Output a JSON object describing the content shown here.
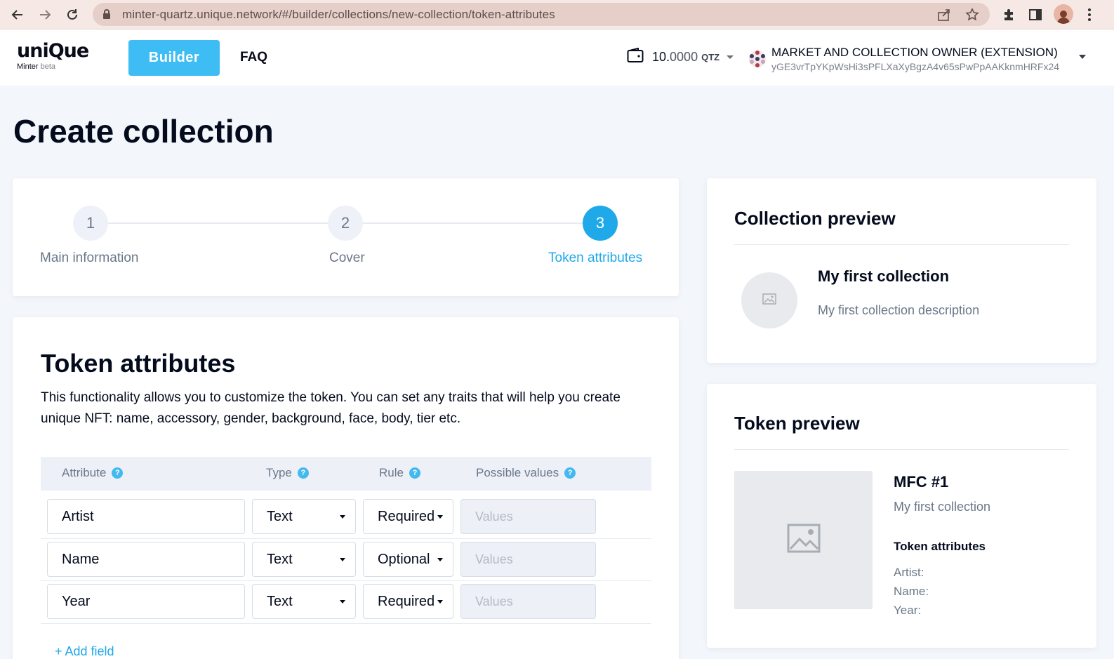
{
  "browser": {
    "url": "minter-quartz.unique.network/#/builder/collections/new-collection/token-attributes"
  },
  "header": {
    "logo_text": "uniQue",
    "logo_sub": "Minter",
    "logo_beta": "beta",
    "builder_label": "Builder",
    "faq_label": "FAQ",
    "wallet_int": "10.",
    "wallet_frac": "0000",
    "wallet_currency": "QTZ",
    "account_name": "MARKET AND COLLECTION OWNER (EXTENSION)",
    "account_address": "yGE3vrTpYKpWsHi3sPFLXaXyBgzA4v65sPwPpAAKknmHRFx24"
  },
  "page": {
    "title": "Create collection"
  },
  "stepper": {
    "steps": [
      {
        "num": "1",
        "label": "Main information"
      },
      {
        "num": "2",
        "label": "Cover"
      },
      {
        "num": "3",
        "label": "Token attributes"
      }
    ]
  },
  "token_attributes": {
    "title": "Token attributes",
    "description_line1": "This functionality allows you to customize the token. You can set any traits that will help you create",
    "description_line2": "unique NFT: name, accessory, gender, background, face, body, tier etc.",
    "columns": {
      "attribute": "Attribute",
      "type": "Type",
      "rule": "Rule",
      "values": "Possible values"
    },
    "rows": [
      {
        "attribute": "Artist",
        "type": "Text",
        "rule": "Required",
        "values_placeholder": "Values"
      },
      {
        "attribute": "Name",
        "type": "Text",
        "rule": "Optional",
        "values_placeholder": "Values"
      },
      {
        "attribute": "Year",
        "type": "Text",
        "rule": "Required",
        "values_placeholder": "Values"
      }
    ],
    "add_field_label": "+ Add field"
  },
  "collection_preview": {
    "title": "Collection preview",
    "name": "My first collection",
    "description": "My first collection description"
  },
  "token_preview": {
    "title": "Token preview",
    "token_name": "MFC #1",
    "collection_name": "My first collection",
    "attributes_heading": "Token attributes",
    "attributes": [
      "Artist:",
      "Name:",
      "Year:"
    ]
  },
  "colors": {
    "accent": "#1fa9e9",
    "builder_button": "#3ebcf4",
    "page_bg": "#f3f6fb"
  },
  "icons": {
    "back": "arrow-left-icon",
    "forward": "arrow-right-icon",
    "reload": "reload-icon",
    "lock": "lock-icon",
    "share": "share-icon",
    "bookmark": "star-icon",
    "extensions": "puzzle-icon",
    "sidepanel": "side-panel-icon",
    "wallet": "wallet-icon",
    "image_placeholder": "image-icon",
    "help": "question-icon"
  }
}
